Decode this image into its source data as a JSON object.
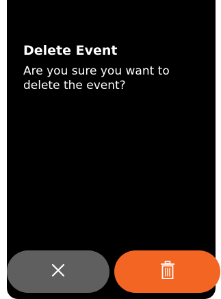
{
  "dialog": {
    "title": "Delete Event",
    "message": "Are you sure you want to delete the event?"
  },
  "buttons": {
    "cancel_icon": "close-icon",
    "delete_icon": "trash-icon"
  },
  "colors": {
    "background": "#000000",
    "cancel_button": "#5f5f5f",
    "delete_button": "#f26522",
    "text": "#ffffff"
  }
}
